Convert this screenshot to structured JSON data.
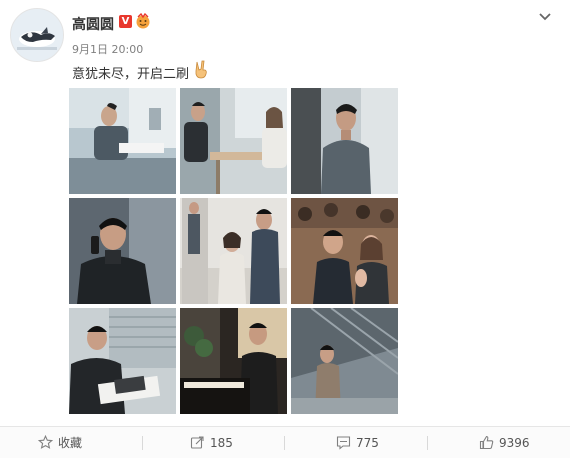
{
  "post": {
    "username": "高圆圆",
    "verified_mark": "V",
    "timestamp": "9月1日 20:00",
    "text": "意犹未尽，开启二刷"
  },
  "photos": [
    {
      "icon": "photo-office-meeting"
    },
    {
      "icon": "photo-cafe-table"
    },
    {
      "icon": "photo-window-portrait"
    },
    {
      "icon": "photo-phone-call"
    },
    {
      "icon": "photo-couple-standing"
    },
    {
      "icon": "photo-audience-clapping"
    },
    {
      "icon": "photo-reading-document"
    },
    {
      "icon": "photo-playing-piano"
    },
    {
      "icon": "photo-rooftop-walk"
    }
  ],
  "actions": {
    "favorite_label": "收藏",
    "repost_count": "185",
    "comment_count": "775",
    "like_count": "9396"
  },
  "colors": {
    "verified": "#e8372d",
    "text_muted": "#808080",
    "footer_bg": "#fbfbfb"
  }
}
